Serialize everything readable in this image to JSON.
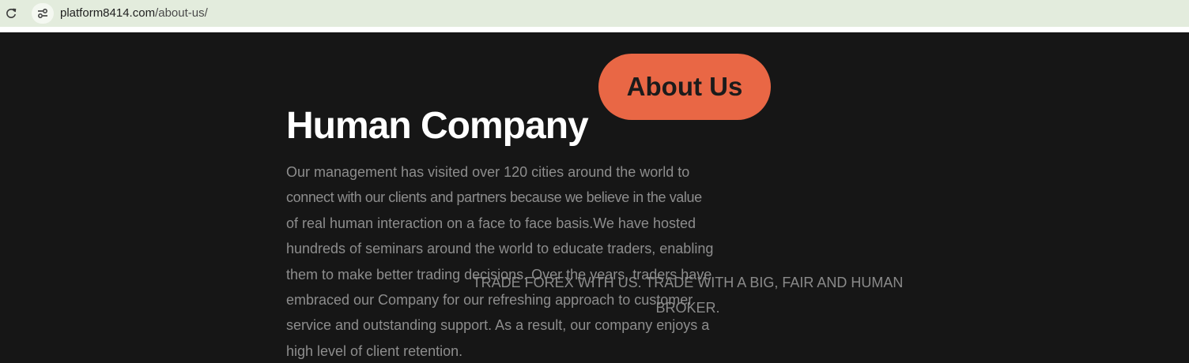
{
  "browser": {
    "url_domain": "platform8414.com",
    "url_path": "/about-us/"
  },
  "header": {
    "about_button": "About Us"
  },
  "main": {
    "heading": "Human Company",
    "paragraph_lines": [
      "Our management has visited over 120 cities around the world to",
      "connect with our clients and partners because we believe in the value",
      "of real human interaction on a face to face basis.We have hosted",
      "hundreds of seminars around the world to educate traders, enabling",
      "them to make better trading decisions. Over the years, traders have",
      "embraced our Company for our refreshing approach to customer",
      "service and outstanding support. As a result, our company enjoys a",
      "high level of client retention."
    ],
    "tagline": "TRADE FOREX WITH US. TRADE WITH A BIG, FAIR AND HUMAN BROKER."
  },
  "colors": {
    "background": "#161616",
    "accent": "#e96745",
    "browser_bar": "#e3ecdd"
  }
}
